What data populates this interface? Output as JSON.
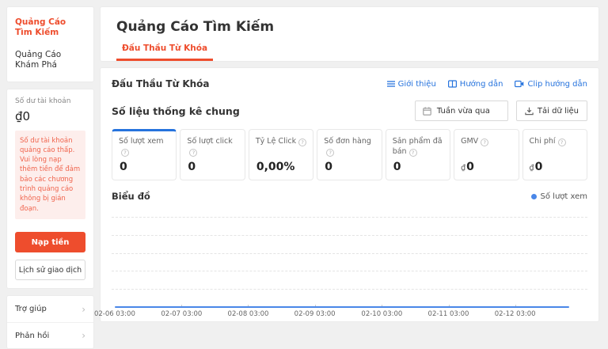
{
  "sidebar": {
    "nav": {
      "search_ads": "Quảng Cáo Tìm Kiếm",
      "discovery_ads": "Quảng Cáo Khám Phá"
    },
    "balance": {
      "label": "Số dư tài khoản",
      "value": "₫0",
      "warning": "Số dư tài khoản quảng cáo thấp. Vui lòng nạp thêm tiền để đảm bảo các chương trình quảng cáo không bị gián đoạn.",
      "topup_label": "Nạp tiền",
      "history_label": "Lịch sử giao dịch"
    },
    "links": {
      "help": "Trợ giúp",
      "feedback": "Phản hồi"
    }
  },
  "header": {
    "title": "Quảng Cáo Tìm Kiếm",
    "tab": "Đấu Thầu Từ Khóa"
  },
  "main": {
    "section_title": "Đấu Thầu Từ Khóa",
    "doc_links": {
      "intro": "Giới thiệu",
      "guide": "Hướng dẫn",
      "clip": "Clip hướng dẫn"
    },
    "stats": {
      "title": "Số liệu thống kê chung",
      "date_range": "Tuần vừa qua",
      "download": "Tải dữ liệu",
      "cards": [
        {
          "label": "Số lượt xem",
          "prefix": "",
          "value": "0"
        },
        {
          "label": "Số lượt click",
          "prefix": "",
          "value": "0"
        },
        {
          "label": "Tỷ Lệ Click",
          "prefix": "",
          "value": "0,00%"
        },
        {
          "label": "Số đơn hàng",
          "prefix": "",
          "value": "0"
        },
        {
          "label": "Sản phẩm đã bán",
          "prefix": "",
          "value": "0"
        },
        {
          "label": "GMV",
          "prefix": "₫",
          "value": "0"
        },
        {
          "label": "Chi phí",
          "prefix": "₫",
          "value": "0"
        }
      ]
    },
    "chart_section_title": "Biểu đồ"
  },
  "colors": {
    "brand_red": "#ee4d2d",
    "link_blue": "#2673dd",
    "series_blue": "#4a87e8",
    "warning_bg": "#fdeeec",
    "warning_text": "#f0644d"
  },
  "chart_data": {
    "type": "line",
    "title": "Biểu đồ",
    "series": [
      {
        "name": "Số lượt xem",
        "values": [
          0,
          0,
          0,
          0,
          0,
          0,
          0
        ],
        "color": "#4a87e8"
      }
    ],
    "x": [
      "02-06 03:00",
      "02-07 03:00",
      "02-08 03:00",
      "02-09 03:00",
      "02-10 03:00",
      "02-11 03:00",
      "02-12 03:00"
    ],
    "ylim": [
      0,
      "auto"
    ],
    "y_axis_labels": "none",
    "grid": "horizontal-dashed",
    "legend_position": "top-right"
  }
}
